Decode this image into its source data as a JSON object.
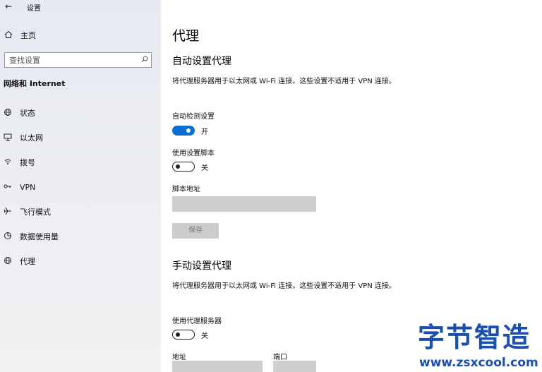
{
  "window": {
    "title": "设置",
    "back_icon": "arrow-left-icon"
  },
  "sidebar": {
    "home_label": "主页",
    "search_placeholder": "查找设置",
    "section_title": "网络和 Internet",
    "items": [
      {
        "label": "状态",
        "icon": "status-globe-icon"
      },
      {
        "label": "以太网",
        "icon": "ethernet-icon"
      },
      {
        "label": "拨号",
        "icon": "dialup-icon"
      },
      {
        "label": "VPN",
        "icon": "vpn-icon"
      },
      {
        "label": "飞行模式",
        "icon": "airplane-icon"
      },
      {
        "label": "数据使用量",
        "icon": "data-usage-icon"
      },
      {
        "label": "代理",
        "icon": "proxy-globe-icon"
      }
    ]
  },
  "main": {
    "title": "代理",
    "auto": {
      "heading": "自动设置代理",
      "description": "将代理服务器用于以太网或 Wi-Fi 连接。这些设置不适用于 VPN 连接。",
      "detect_label": "自动检测设置",
      "detect_state": "开",
      "script_label": "使用设置脚本",
      "script_state": "关",
      "address_label": "脚本地址",
      "address_value": "",
      "save_label": "保存"
    },
    "manual": {
      "heading": "手动设置代理",
      "description": "将代理服务器用于以太网或 Wi-Fi 连接。这些设置不适用于 VPN 连接。",
      "use_proxy_label": "使用代理服务器",
      "use_proxy_state": "关",
      "address_label": "地址",
      "port_label": "端口"
    }
  },
  "watermark": {
    "logo_text": "字节智造",
    "domain": "www.zsxcool.com"
  },
  "colors": {
    "accent": "#0a6ed1",
    "watermark": "#1a4fb0"
  }
}
